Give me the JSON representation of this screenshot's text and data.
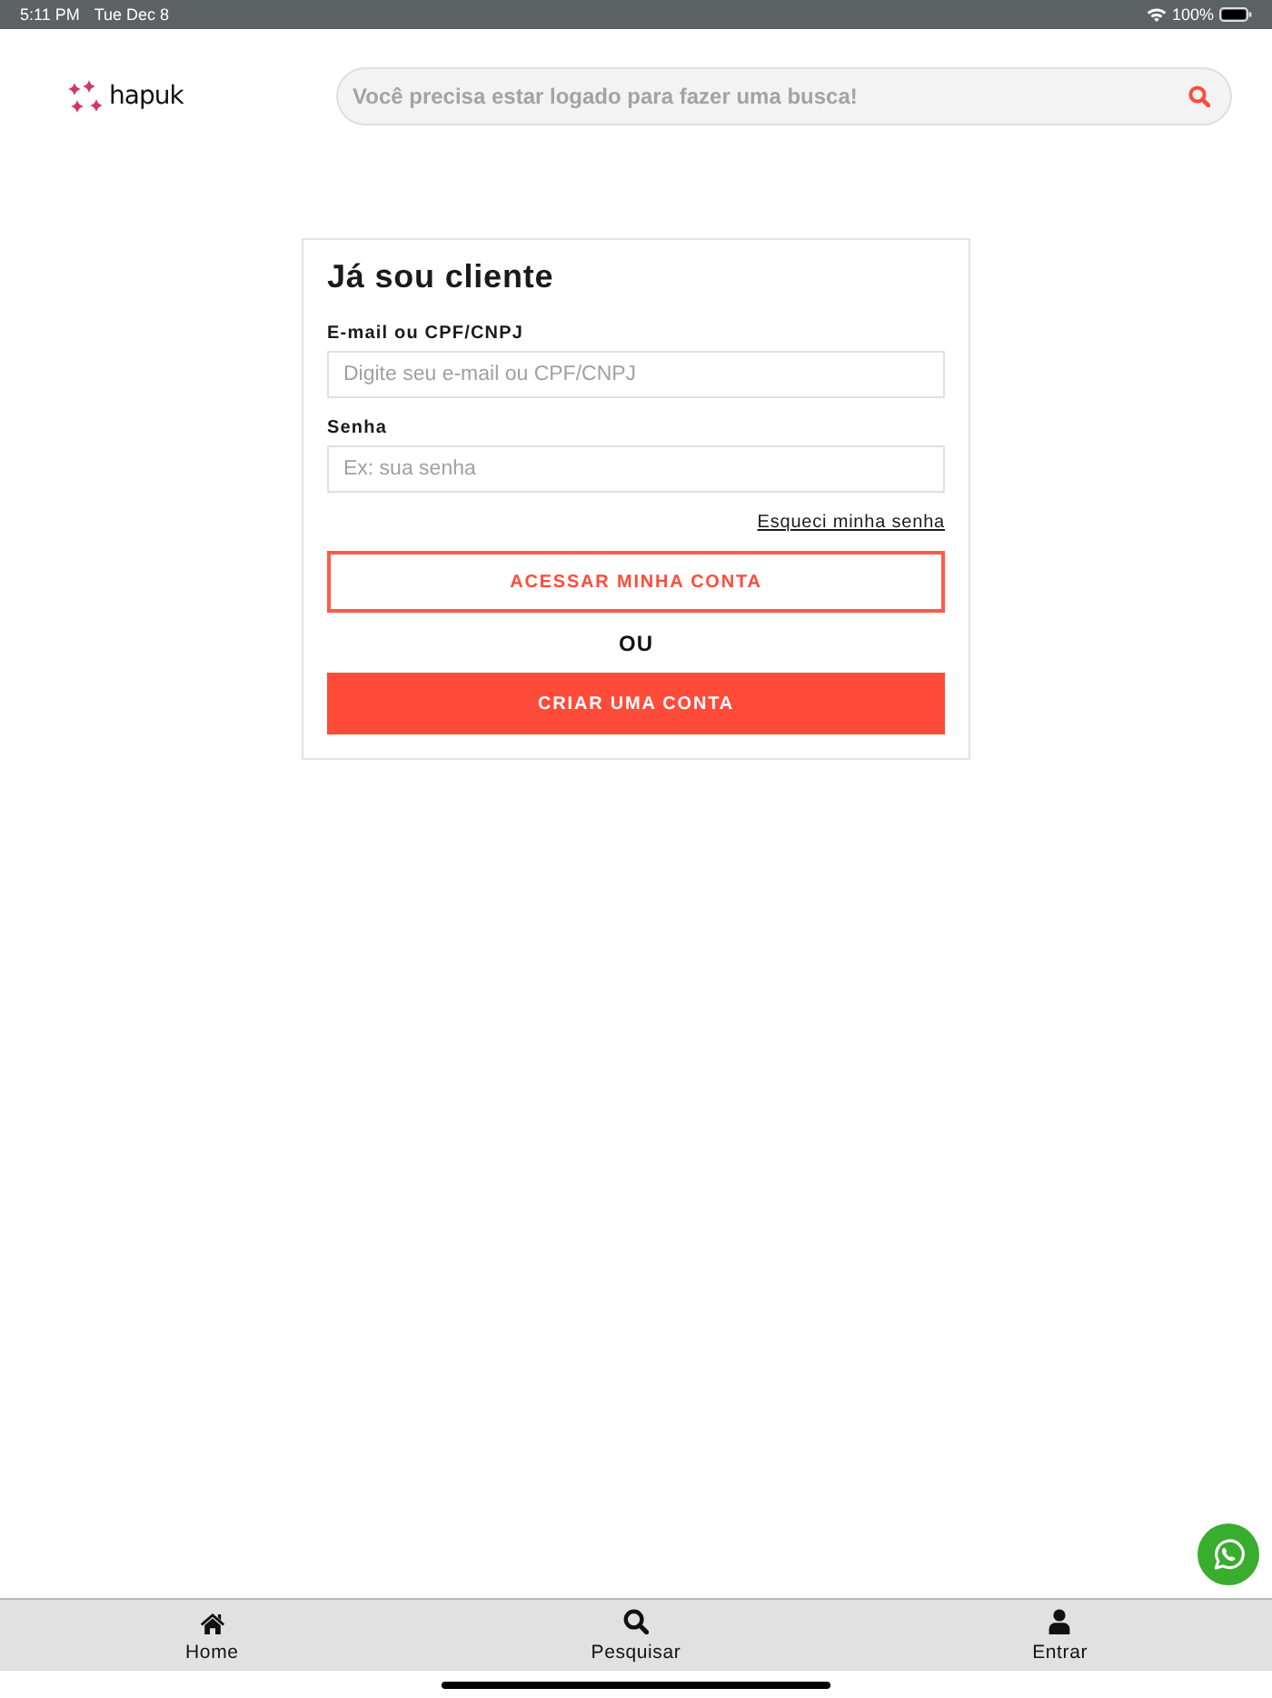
{
  "status_bar": {
    "time": "5:11 PM",
    "date": "Tue Dec 8",
    "battery": "100%"
  },
  "header": {
    "logo": "hapuk",
    "search": {
      "placeholder": "Você precisa estar logado para fazer uma busca!"
    }
  },
  "login": {
    "title": "Já sou cliente",
    "fields": [
      {
        "label": "E-mail ou CPF/CNPJ",
        "placeholder": "Digite seu e-mail ou CPF/CNPJ"
      },
      {
        "label": "Senha",
        "placeholder": "Ex: sua senha"
      }
    ],
    "forgot_link": "Esqueci minha senha",
    "actions": [
      {
        "kind": "outline",
        "label": "ACESSAR MINHA CONTA"
      },
      {
        "kind": "separator",
        "label": "OU"
      },
      {
        "kind": "filled",
        "label": "CRIAR UMA CONTA"
      }
    ]
  },
  "tab_bar": {
    "items": [
      {
        "kind": "home",
        "label": "Home"
      },
      {
        "kind": "search",
        "label": "Pesquisar"
      },
      {
        "kind": "account",
        "label": "Entrar"
      }
    ]
  }
}
